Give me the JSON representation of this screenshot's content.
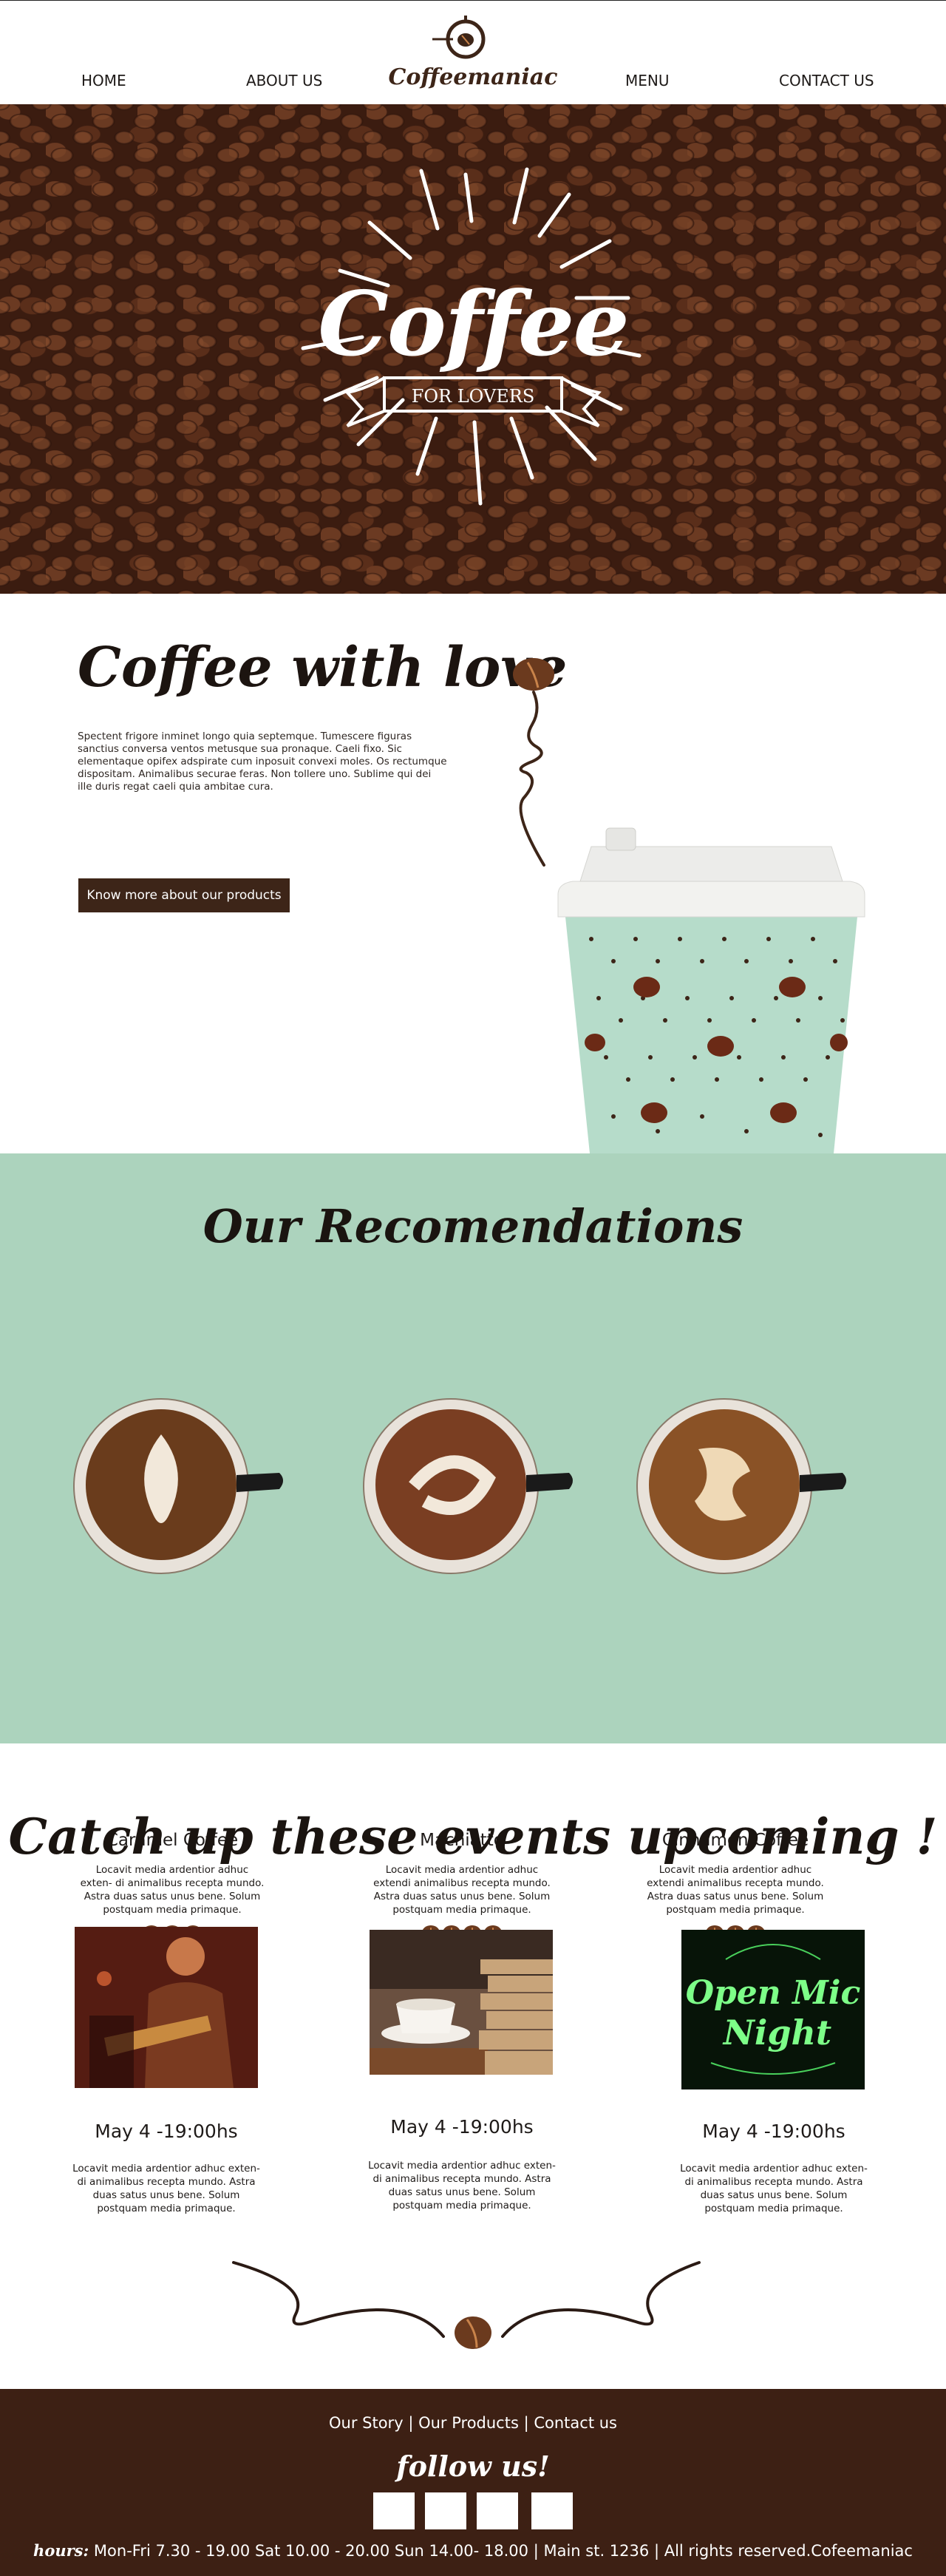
{
  "header": {
    "nav": [
      "HOME",
      "ABOUT US",
      "MENU",
      "CONTACT US"
    ],
    "logo": "Coffeemaniac"
  },
  "hero": {
    "title": "Coffee",
    "banner": "FOR LOVERS"
  },
  "love": {
    "title": "Coffee with love",
    "text": "Spectent frigore inminet longo quia septemque. Tumescere figuras sanctius conversa ventos metusque sua pronaque. Caeli fixo. Sic elementaque opifex adspirate cum inposuit convexi moles. Os rectumque dispositam. Animalibus securae feras. Non tollere uno. Sublime qui dei ille duris regat caeli quia ambitae cura.",
    "button": "Know more about our products"
  },
  "recommendations": {
    "title": "Our Recomendations",
    "items": [
      {
        "name": "Caramel Coffee",
        "desc": "Locavit media ardentior adhuc exten- di animalibus recepta mundo. Astra duas satus unus bene. Solum postquam media primaque.",
        "rating": 3
      },
      {
        "name": "Machiatto",
        "desc": "Locavit media ardentior adhuc extendi animalibus recepta mundo. Astra duas satus unus bene. Solum postquam media primaque.",
        "rating": 4
      },
      {
        "name": "Cinnamon Coffee",
        "desc": "Locavit media ardentior adhuc extendi animalibus recepta mundo. Astra duas satus unus bene. Solum postquam media primaque.",
        "rating": 3
      }
    ]
  },
  "events": {
    "title": "Catch up these events upcoming !",
    "items": [
      {
        "date": "May 4 -19:00hs",
        "desc": "Locavit media ardentior adhuc exten- di animalibus recepta mundo. Astra duas satus unus bene. Solum postquam media primaque."
      },
      {
        "date": "May 4 -19:00hs",
        "desc": "Locavit media ardentior adhuc exten- di animalibus recepta mundo. Astra duas satus unus bene. Solum postquam media primaque."
      },
      {
        "date": "May 4 -19:00hs",
        "desc": "Locavit media ardentior adhuc exten- di animalibus recepta mundo. Astra duas satus unus bene. Solum postquam media primaque."
      }
    ],
    "neon_sign": "Open Mic Night"
  },
  "footer": {
    "links": [
      "Our Story",
      "Our Products",
      "Contact us"
    ],
    "separator": "|",
    "follow": "follow us!",
    "hours_label": "hours:",
    "hours": "Mon-Fri 7.30 - 19.00 Sat  10.00 - 20.00 Sun  14.00- 18.00",
    "address": "Main st. 1236",
    "rights": "All rights reserved.Cofeemaniac"
  },
  "colors": {
    "brown_dark": "#3d2014",
    "mint": "#acd3bd",
    "bean": "#6b3a1e"
  }
}
